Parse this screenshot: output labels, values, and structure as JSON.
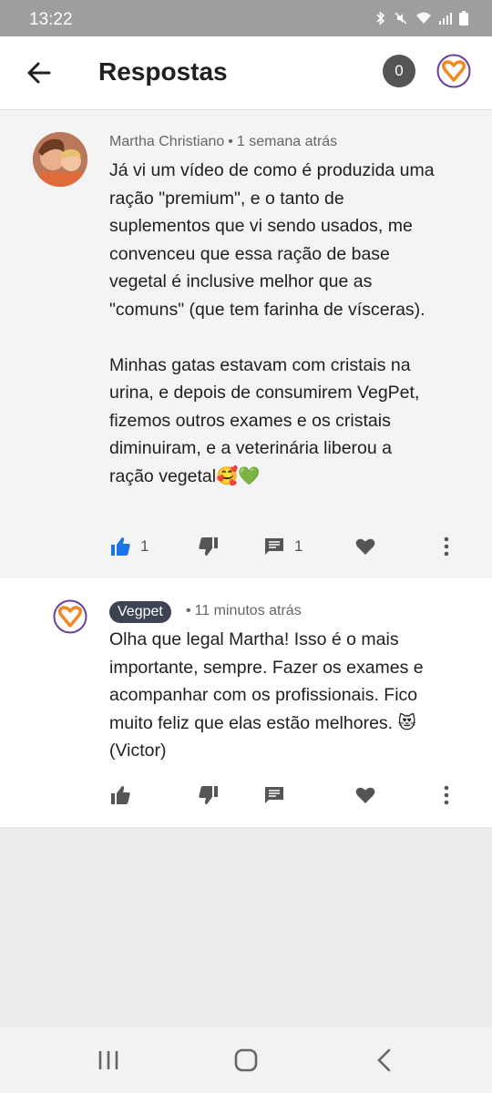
{
  "status_bar": {
    "time": "13:22"
  },
  "header": {
    "title": "Respostas",
    "notification_count": "0"
  },
  "comment": {
    "author": "Martha Christiano",
    "separator": "•",
    "time": "1 semana atrás",
    "paragraphs": [
      "Já vi um vídeo de como é produzida uma ração \"premium\", e o tanto de suplementos que vi sendo usados, me convenceu que essa ração de base vegetal é inclusive melhor que as \"comuns\" (que tem farinha de vísceras).",
      "Minhas gatas estavam com cristais na urina, e depois de consumirem VegPet, fizemos outros exames e os cristais diminuiram, e a veterinária liberou a ração vegetal🥰💚"
    ],
    "likes": "1",
    "replies": "1"
  },
  "reply": {
    "author": "Vegpet",
    "separator": "•",
    "time": "11 minutos atrás",
    "text": "Olha que legal Martha! Isso é o mais importante, sempre. Fazer os exames e acompanhar com os profissionais. Fico muito feliz que elas estão melhores. 😻 (Victor)"
  },
  "colors": {
    "accent_blue": "#1a73e8",
    "brand_orange": "#f5871f",
    "brand_purple": "#6a3fa0",
    "icon_gray": "#555555",
    "chip_bg": "#3d4451"
  },
  "icons": {
    "back": "arrow-left-icon",
    "logo": "heart-logo-icon",
    "like": "thumb-up-icon",
    "dislike": "thumb-down-icon",
    "reply": "comment-icon",
    "heart": "heart-icon",
    "more": "more-vertical-icon"
  }
}
